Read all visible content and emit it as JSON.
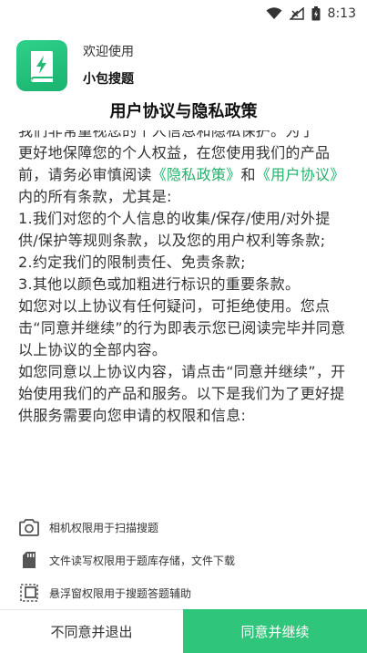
{
  "status_bar": {
    "time": "8:13"
  },
  "header": {
    "welcome": "欢迎使用",
    "app_name": "小包搜题"
  },
  "dialog_title": "用户协议与隐私政策",
  "content": {
    "p1_top": "我们非常重视您的个人信息和隐私保护。为了",
    "p1_a": "更好地保障您的个人权益，在您使用我们的产品前，请务必审慎阅读",
    "link_privacy": "《隐私政策》",
    "p1_and": "和",
    "link_user": "《用户协议》",
    "p1_b": "内的所有条款，尤其是:",
    "item1": " 1.我们对您的个人信息的收集/保存/使用/对外提供/保护等规则条款，以及您的用户权利等条款;",
    "item2": " 2.约定我们的限制责任、免责条款;",
    "item3": " 3.其他以颜色或加粗进行标识的重要条款。",
    "p2": " 如您对以上协议有任何疑问，可拒绝使用。您点击“同意并继续”的行为即表示您已阅读完毕并同意以上协议的全部内容。",
    "p3": " 如您同意以上协议内容，请点击“同意并继续”，开始使用我们的产品和服务。以下是我们为了更好提供服务需要向您申请的权限和信息:"
  },
  "permissions": [
    {
      "icon": "camera-icon",
      "label": "相机权限用于扫描搜题"
    },
    {
      "icon": "sd-card-icon",
      "label": "文件读写权限用于题库存储，文件下载"
    },
    {
      "icon": "floating-window-icon",
      "label": "悬浮窗权限用于搜题答题辅助"
    }
  ],
  "buttons": {
    "decline": "不同意并退出",
    "agree": "同意并继续"
  },
  "colors": {
    "accent": "#2fc57a",
    "link": "#21b36a",
    "icon_gradient_top": "#2fd18a"
  }
}
